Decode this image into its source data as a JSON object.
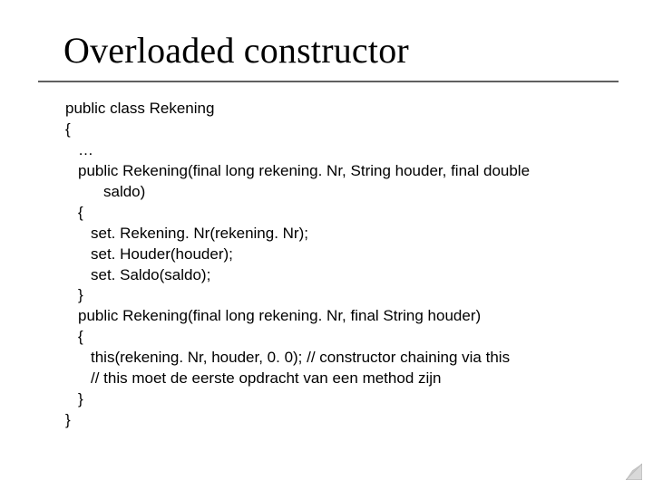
{
  "title": "Overloaded constructor",
  "code": {
    "l00": "public class Rekening",
    "l01": "{",
    "l02": "…",
    "l03a": "public Rekening(final long rekening. Nr, String houder, final double",
    "l03b": "saldo)",
    "l04": "{",
    "l05": "set. Rekening. Nr(rekening. Nr);",
    "l06": "set. Houder(houder);",
    "l07": "set. Saldo(saldo);",
    "l08": "}",
    "l09": "public Rekening(final long rekening. Nr, final String houder)",
    "l10": "{",
    "l11": "this(rekening. Nr, houder, 0. 0);  // constructor chaining via this",
    "l12": "// this moet de eerste opdracht van een method zijn",
    "l13": "}",
    "l14": "}"
  }
}
